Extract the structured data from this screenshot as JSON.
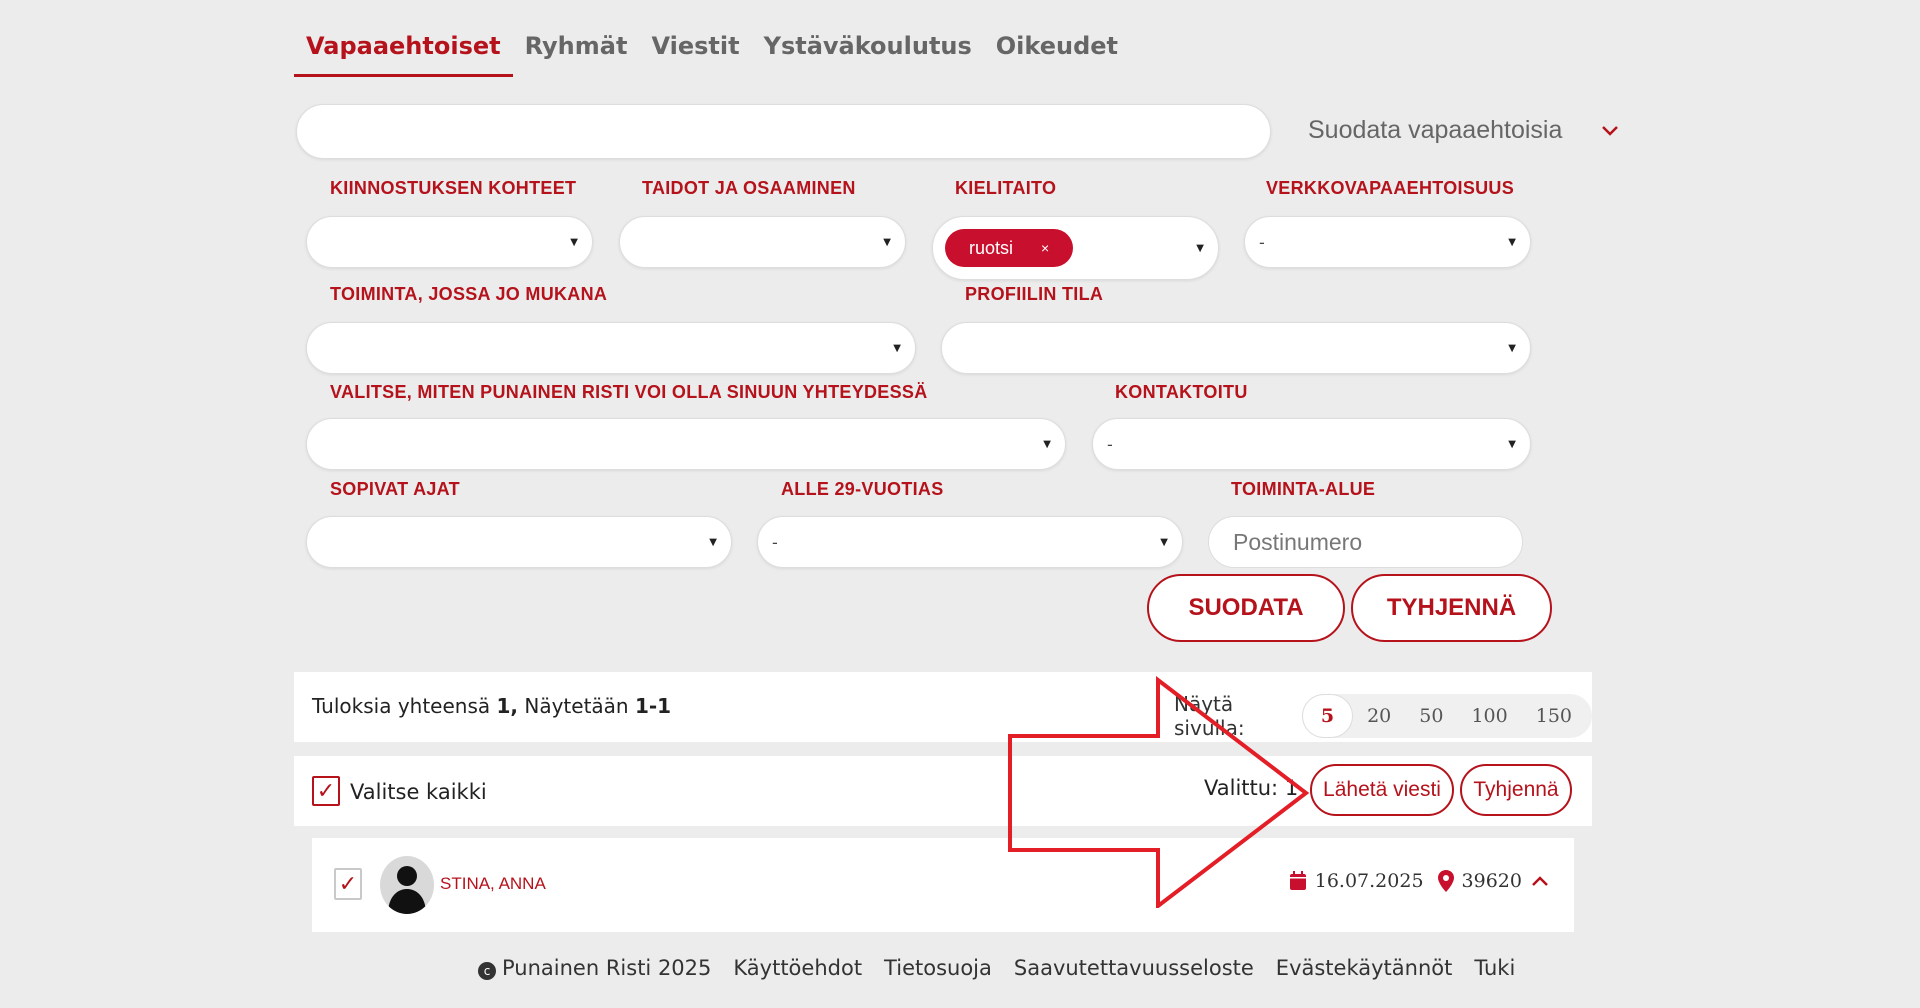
{
  "tabs": [
    "Vapaaehtoiset",
    "Ryhmät",
    "Viestit",
    "Ystäväkoulutus",
    "Oikeudet"
  ],
  "filters": {
    "toggle_label": "Suodata vapaaehtoisia",
    "labels": {
      "kiinnostus": "KIINNOSTUKSEN KOHTEET",
      "taidot": "TAIDOT JA OSAAMINEN",
      "kielitaito": "KIELITAITO",
      "verkko": "VERKKOVAPAAEHTOISUUS",
      "toiminta": "TOIMINTA, JOSSA JO MUKANA",
      "profiili": "PROFIILIN TILA",
      "yhteys": "VALITSE, MITEN PUNAINEN RISTI VOI OLLA SINUUN YHTEYDESSÄ",
      "kontaktoitu": "KONTAKTOITU",
      "ajat": "SOPIVAT AJAT",
      "alle29": "ALLE 29-VUOTIAS",
      "alue": "TOIMINTA-ALUE"
    },
    "values": {
      "verkko": "-",
      "kontaktoitu": "-",
      "alle29": "-"
    },
    "kielitaito_chip": "ruotsi",
    "chip_remove": "×",
    "postal_placeholder": "Postinumero",
    "filter_button": "SUODATA",
    "clear_button": "TYHJENNÄ"
  },
  "results": {
    "prefix": "Tuloksia yhteensä",
    "total": "1,",
    "shown_prefix": "Näytetään",
    "shown_range": "1-1",
    "per_page_label": "Näytä sivulla:",
    "per_page_options": [
      "5",
      "20",
      "50",
      "100",
      "150"
    ],
    "per_page_selected": "5"
  },
  "selection": {
    "checkmark": "✓",
    "select_all": "Valitse kaikki",
    "selected_label": "Valittu:",
    "selected_count": "1",
    "send_message": "Lähetä viesti",
    "clear": "Tyhjennä"
  },
  "volunteer": {
    "name": "STINA, ANNA",
    "date": "16.07.2025",
    "postal": "39620"
  },
  "footer": {
    "copyright_symbol": "c",
    "copyright": "Punainen Risti 2025",
    "links": [
      "Käyttöehdot",
      "Tietosuoja",
      "Saavutettavuusseloste",
      "Evästekäytännöt",
      "Tuki"
    ]
  },
  "colors": {
    "brand_red": "#b5121b",
    "arrow_red": "#e41e26",
    "background": "#ececec"
  }
}
